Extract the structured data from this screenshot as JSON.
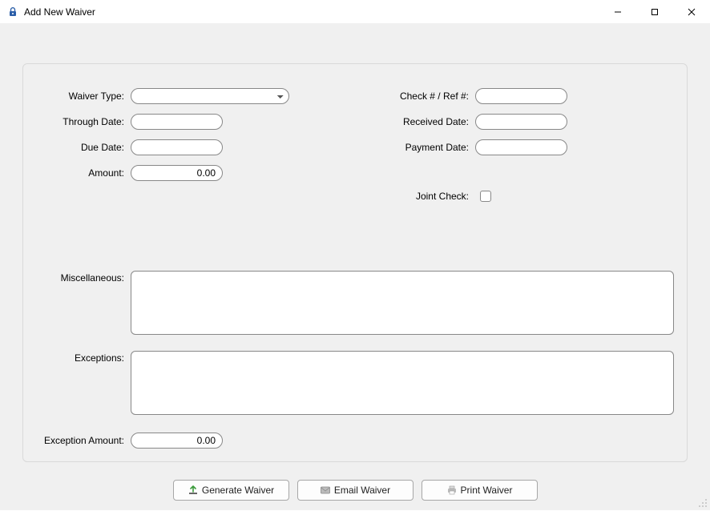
{
  "window": {
    "title": "Add New Waiver"
  },
  "labels": {
    "waiver_type": "Waiver Type:",
    "through_date": "Through Date:",
    "due_date": "Due Date:",
    "amount": "Amount:",
    "check_ref": "Check # / Ref #:",
    "received_date": "Received Date:",
    "payment_date": "Payment Date:",
    "joint_check": "Joint Check:",
    "miscellaneous": "Miscellaneous:",
    "exceptions": "Exceptions:",
    "exception_amount": "Exception Amount:"
  },
  "values": {
    "waiver_type": "",
    "through_date": "",
    "due_date": "",
    "amount": "0.00",
    "check_ref": "",
    "received_date": "",
    "payment_date": "",
    "joint_check_checked": false,
    "miscellaneous": "",
    "exceptions": "",
    "exception_amount": "0.00"
  },
  "buttons": {
    "generate": "Generate Waiver",
    "email": "Email Waiver",
    "print": "Print Waiver"
  }
}
